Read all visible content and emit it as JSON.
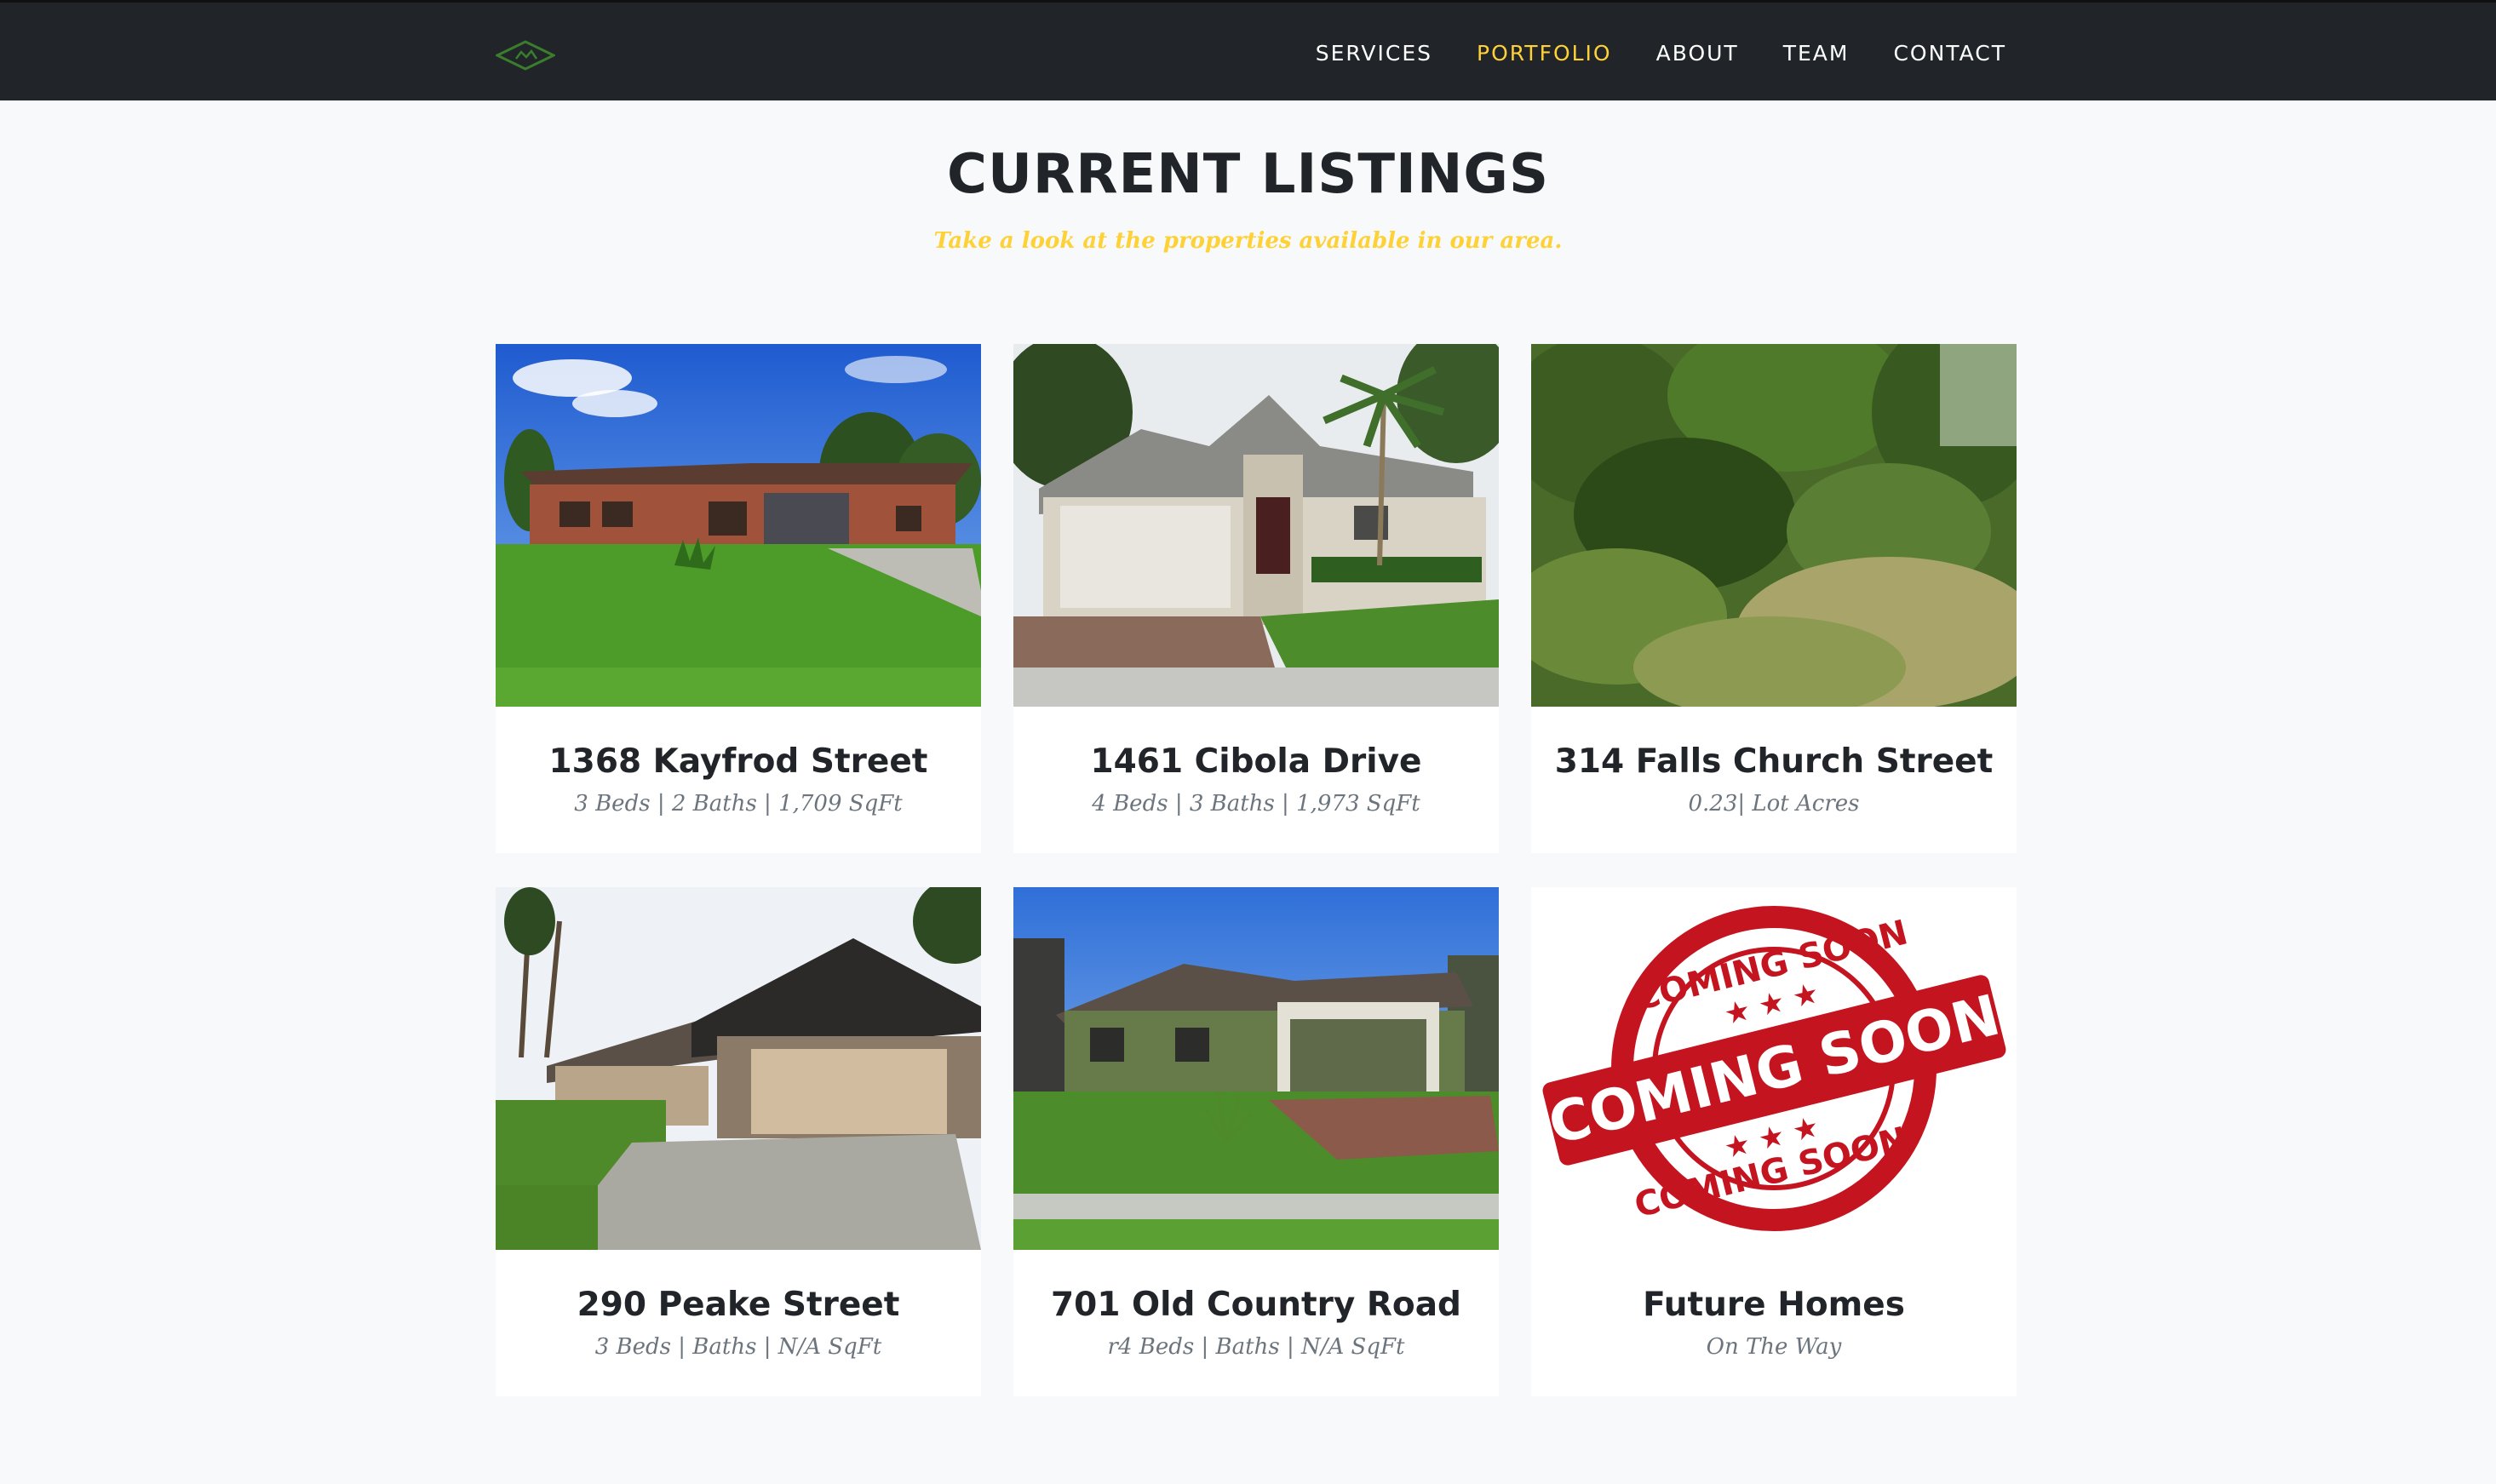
{
  "nav": {
    "logo_icon": "house-diamond-logo",
    "items": [
      "SERVICES",
      "PORTFOLIO",
      "ABOUT",
      "TEAM",
      "CONTACT"
    ],
    "active_item": "PORTFOLIO"
  },
  "colors": {
    "navbar_bg": "#212529",
    "accent": "#fed136",
    "heading": "#212529",
    "muted": "#6c757d",
    "page_bg": "#f8f9fa"
  },
  "section": {
    "heading": "CURRENT LISTINGS",
    "subheading": "Take a look at the properties available in our area."
  },
  "listings": [
    {
      "title": "1368 Kayfrod Street",
      "details": "3 Beds | 2 Baths | 1,709 SqFt",
      "image": "brick-ranch-house-photo"
    },
    {
      "title": "1461 Cibola Drive",
      "details": "4 Beds | 3 Baths | 1,973 SqFt",
      "image": "stucco-house-with-palm-photo"
    },
    {
      "title": "314 Falls Church Street",
      "details": "0.23| Lot Acres",
      "image": "wooded-lot-photo"
    },
    {
      "title": "290 Peake Street",
      "details": "3 Beds | Baths | N/A SqFt",
      "image": "house-with-garage-photo"
    },
    {
      "title": "701 Old Country Road",
      "details": "r4 Beds | Baths | N/A SqFt",
      "image": "green-house-photo"
    },
    {
      "title": "Future Homes",
      "details": "On The Way",
      "image": "coming-soon-stamp",
      "stamp_texts": [
        "COMING SOON",
        "COMING SOON",
        "COMING SOON"
      ]
    }
  ]
}
